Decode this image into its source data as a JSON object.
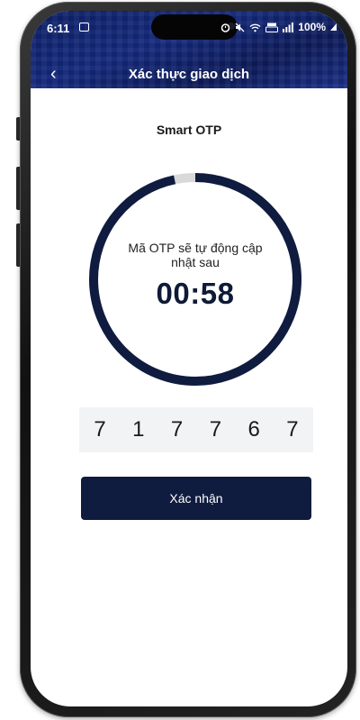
{
  "status_bar": {
    "time": "6:11",
    "battery": "100%",
    "icons": [
      "image-icon",
      "alarm-icon",
      "mute-icon",
      "wifi-icon",
      "volte-icon",
      "signal-icon",
      "battery-icon"
    ]
  },
  "header": {
    "back_icon": "chevron-left-icon",
    "back_glyph": "‹",
    "title": "Xác thực giao dịch",
    "background": "#13257a"
  },
  "main": {
    "subtitle": "Smart OTP",
    "countdown": {
      "caption": "Mã OTP sẽ tự động cập nhật sau",
      "time": "00:58",
      "remaining_fraction": 0.967,
      "ring_color": "#0f1c3f",
      "ring_track_color": "#d9d9d9"
    },
    "otp_digits": [
      "7",
      "1",
      "7",
      "7",
      "6",
      "7"
    ],
    "confirm_label": "Xác nhận",
    "confirm_color": "#0f1c3f"
  }
}
